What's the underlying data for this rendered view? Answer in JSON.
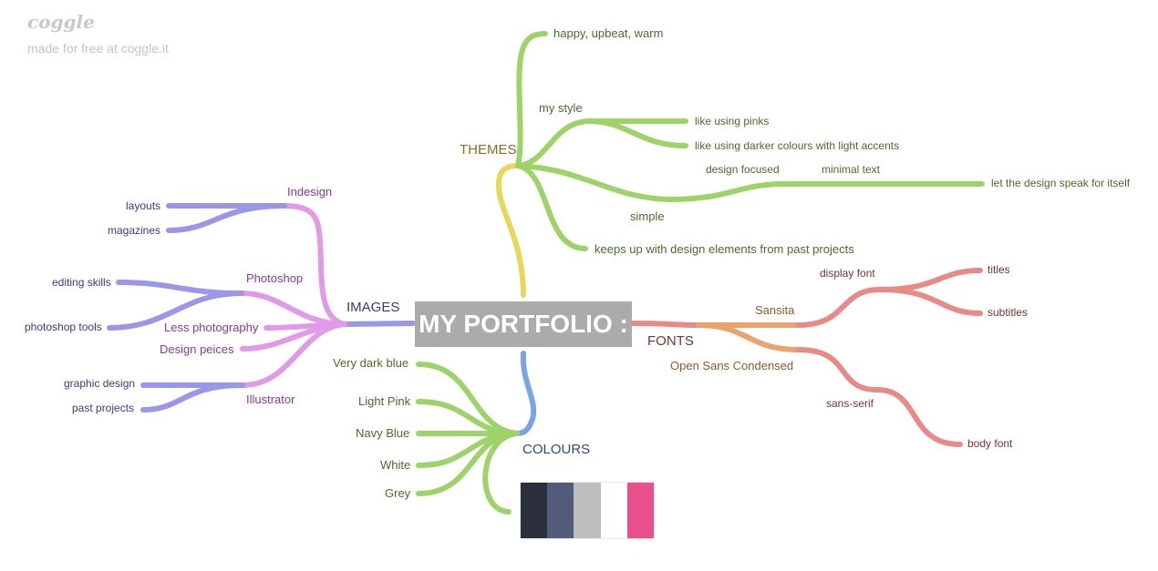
{
  "brand": {
    "logo": "coggle",
    "tagline": "made for free at coggle.it"
  },
  "root": {
    "label": "MY PORTFOLIO :"
  },
  "branches": {
    "themes": {
      "label": "THEMES",
      "items": {
        "warm": "happy, upbeat, warm",
        "my_style": "my style",
        "pinks": "like using pinks",
        "darker": "like using darker colours with light accents",
        "simple": "simple",
        "design_focused": "design focused",
        "minimal_text": "minimal text",
        "speak": "let the design speak for itself",
        "keeps_up": "keeps up with design elements from past projects"
      }
    },
    "images": {
      "label": "IMAGES",
      "items": {
        "indesign": "Indesign",
        "layouts": "layouts",
        "magazines": "magazines",
        "photoshop": "Photoshop",
        "editing": "editing skills",
        "ps_tools": "photoshop tools",
        "less_photo": "Less photography",
        "design_peices": "Design peices",
        "illustrator": "Illustrator",
        "graphic": "graphic design",
        "past": "past projects"
      }
    },
    "fonts": {
      "label": "FONTS",
      "items": {
        "sansita": "Sansita",
        "display": "display font",
        "titles": "titles",
        "subtitles": "subtitles",
        "open_sans": "Open Sans Condensed",
        "sans_serif": "sans-serif",
        "body_font": "body font"
      }
    },
    "colours": {
      "label": "COLOURS",
      "items": {
        "very_dark": "Very dark blue",
        "light_pink": "Light Pink",
        "navy": "Navy Blue",
        "white": "White",
        "grey": "Grey"
      },
      "swatches": [
        "#2b2f3b",
        "#525c78",
        "#bdbebf",
        "#ffffff",
        "#e84f8c"
      ]
    }
  },
  "colors": {
    "themes_trunk": "#e8d75a",
    "themes": "#9ed36a",
    "images_trunk": "#9a96e8",
    "images": "#e09ae8",
    "images_leaf": "#9a96e8",
    "fonts_trunk": "#e88a86",
    "fonts_mid": "#eaa36c",
    "fonts_leaf": "#e88a86",
    "colours_trunk": "#7aa3e8",
    "colours": "#9ed36a"
  }
}
